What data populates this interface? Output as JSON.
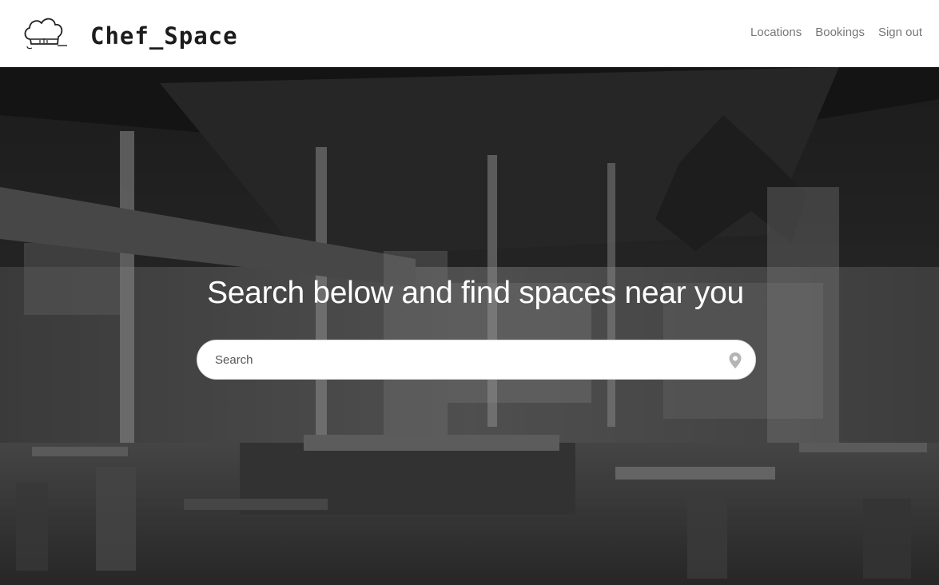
{
  "brand": {
    "name": "Chef_Space",
    "logo_icon": "chef-hat-icon"
  },
  "nav": {
    "items": [
      {
        "label": "Locations"
      },
      {
        "label": "Bookings"
      },
      {
        "label": "Sign out"
      }
    ]
  },
  "hero": {
    "title": "Search below and find spaces near you",
    "background": "dark industrial restaurant interior photo",
    "search": {
      "placeholder": "Search",
      "value": "",
      "icon": "map-pin-icon"
    }
  },
  "colors": {
    "nav_text": "#777777",
    "hero_title": "#ffffff",
    "header_bg": "#ffffff"
  }
}
